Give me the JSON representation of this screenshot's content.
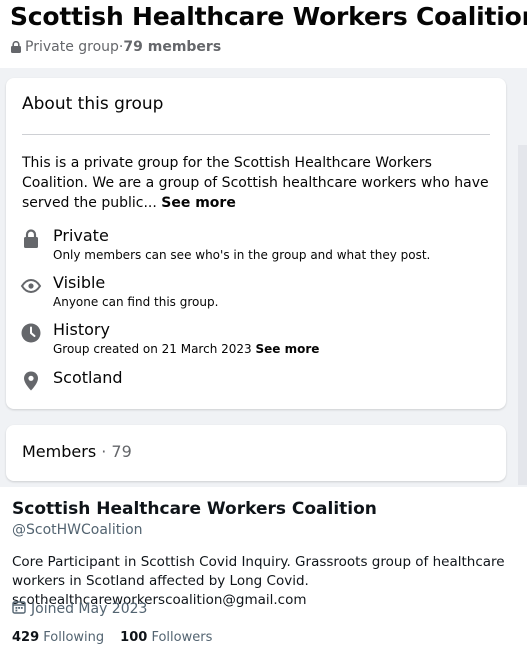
{
  "group": {
    "title": "Scottish Healthcare Workers Coalition",
    "privacy": "Private group",
    "separator": " · ",
    "members_count": "79 members"
  },
  "about": {
    "heading": "About this group",
    "description": "This is a private group for the Scottish Healthcare Workers Coalition. We are a group of Scottish healthcare workers who have served the public...",
    "see_more": "See more",
    "rows": [
      {
        "icon": "lock-icon",
        "title": "Private",
        "sub": "Only members can see who's in the group and what they post."
      },
      {
        "icon": "eye-icon",
        "title": "Visible",
        "sub": "Anyone can find this group."
      },
      {
        "icon": "clock-icon",
        "title": "History",
        "sub": "Group created on 21 March 2023",
        "sub_link": "See more"
      },
      {
        "icon": "location-pin-icon",
        "title": "Scotland"
      }
    ]
  },
  "members": {
    "label": "Members",
    "separator": " · ",
    "count": "79"
  },
  "twitter": {
    "name": "Scottish Healthcare Workers Coalition",
    "handle": "@ScotHWCoalition",
    "bio": "Core Participant in Scottish Covid Inquiry. Grassroots group of healthcare workers in Scotland affected by Long Covid. scothealthcareworkerscoalition@gmail.com",
    "joined": "Joined May 2023",
    "following_count": "429",
    "following_label": "Following",
    "followers_count": "100",
    "followers_label": "Followers"
  },
  "colors": {
    "page_bg": "#f0f2f5",
    "card_bg": "#ffffff",
    "secondary_text": "#65676b",
    "icon_gray": "#65676b"
  }
}
